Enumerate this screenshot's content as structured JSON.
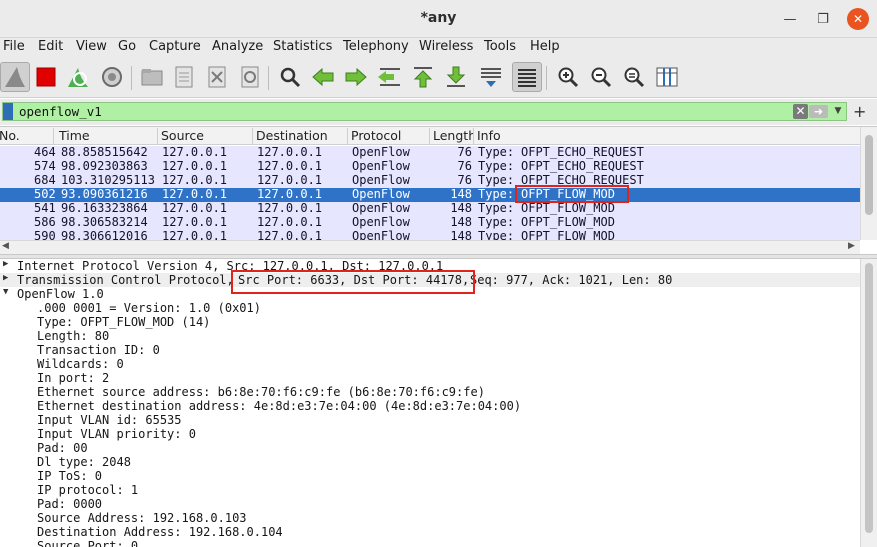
{
  "window": {
    "title": "*any"
  },
  "menu": [
    "File",
    "Edit",
    "View",
    "Go",
    "Capture",
    "Analyze",
    "Statistics",
    "Telephony",
    "Wireless",
    "Tools",
    "Help"
  ],
  "toolbar_icons": [
    "shark-fin-start-icon",
    "stop-capture-icon",
    "restart-capture-icon",
    "capture-options-icon",
    "open-file-icon",
    "save-file-icon",
    "close-file-icon",
    "reload-file-icon",
    "find-packet-icon",
    "go-back-icon",
    "go-forward-icon",
    "go-to-packet-icon",
    "go-first-packet-icon",
    "go-last-packet-icon",
    "auto-scroll-icon",
    "colorize-icon",
    "zoom-in-icon",
    "zoom-out-icon",
    "zoom-normal-icon",
    "resize-columns-icon"
  ],
  "filter": {
    "value": "openflow_v1",
    "colors": {
      "bg": "#aff0a5"
    }
  },
  "packet_list": {
    "columns": [
      "No.",
      "Time",
      "Source",
      "Destination",
      "Protocol",
      "Length",
      "Info"
    ],
    "rows": [
      {
        "no": "464",
        "time": "88.858515642",
        "src": "127.0.0.1",
        "dst": "127.0.0.1",
        "proto": "OpenFlow",
        "len": "76",
        "info_prefix": "Type: ",
        "info_type": "OFPT_ECHO_REQUEST"
      },
      {
        "no": "574",
        "time": "98.092303863",
        "src": "127.0.0.1",
        "dst": "127.0.0.1",
        "proto": "OpenFlow",
        "len": "76",
        "info_prefix": "Type: ",
        "info_type": "OFPT_ECHO_REQUEST"
      },
      {
        "no": "684",
        "time": "103.310295113",
        "src": "127.0.0.1",
        "dst": "127.0.0.1",
        "proto": "OpenFlow",
        "len": "76",
        "info_prefix": "Type: ",
        "info_type": "OFPT_ECHO_REQUEST"
      },
      {
        "no": "502",
        "time": "93.090361216",
        "src": "127.0.0.1",
        "dst": "127.0.0.1",
        "proto": "OpenFlow",
        "len": "148",
        "info_prefix": "Type: ",
        "info_type": "OFPT_FLOW_MOD",
        "selected": true
      },
      {
        "no": "541",
        "time": "96.163323864",
        "src": "127.0.0.1",
        "dst": "127.0.0.1",
        "proto": "OpenFlow",
        "len": "148",
        "info_prefix": "Type: ",
        "info_type": "OFPT_FLOW_MOD"
      },
      {
        "no": "586",
        "time": "98.306583214",
        "src": "127.0.0.1",
        "dst": "127.0.0.1",
        "proto": "OpenFlow",
        "len": "148",
        "info_prefix": "Type: ",
        "info_type": "OFPT_FLOW_MOD"
      },
      {
        "no": "590",
        "time": "98.306612016",
        "src": "127.0.0.1",
        "dst": "127.0.0.1",
        "proto": "OpenFlow",
        "len": "148",
        "info_prefix": "Type: ",
        "info_type": "OFPT_FLOW_MOD"
      }
    ]
  },
  "details": {
    "ip_line": "Internet Protocol Version 4, Src: 127.0.0.1, Dst: 127.0.0.1",
    "tcp_prefix": "Transmission Control Protocol, ",
    "tcp_ports": "Src Port: 6633, Dst Port: 44178,",
    "tcp_suffix": " Seq: 977, Ack: 1021, Len: 80",
    "openflow_header": "OpenFlow 1.0",
    "fields": [
      ".000 0001 = Version: 1.0 (0x01)",
      "Type: OFPT_FLOW_MOD (14)",
      "Length: 80",
      "Transaction ID: 0",
      "Wildcards: 0",
      "In port: 2",
      "Ethernet source address: b6:8e:70:f6:c9:fe (b6:8e:70:f6:c9:fe)",
      "Ethernet destination address: 4e:8d:e3:7e:04:00 (4e:8d:e3:7e:04:00)",
      "Input VLAN id: 65535",
      "Input VLAN priority: 0",
      "Pad: 00",
      "Dl type: 2048",
      "IP ToS: 0",
      "IP protocol: 1",
      "Pad: 0000",
      "Source Address: 192.168.0.103",
      "Destination Address: 192.168.0.104",
      "Source Port: 0"
    ]
  },
  "colors": {
    "selected_row": "#2f73c9",
    "row_bg": "#e7e6ff",
    "highlight_box": "#e2231a",
    "close_button": "#e95420"
  }
}
